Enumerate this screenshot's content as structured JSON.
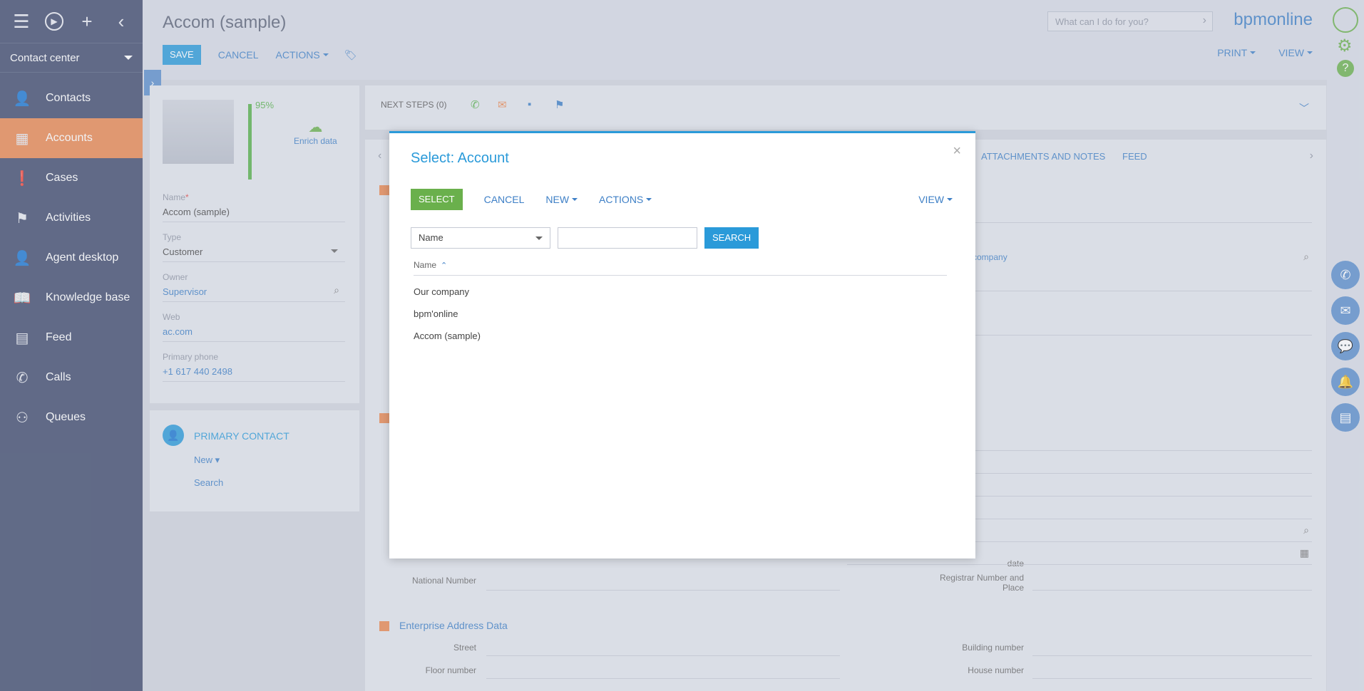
{
  "sidebar": {
    "workplace": "Contact center",
    "items": [
      {
        "label": "Contacts",
        "icon": "person-icon",
        "active": false
      },
      {
        "label": "Accounts",
        "icon": "building-icon",
        "active": true
      },
      {
        "label": "Cases",
        "icon": "exclamation-icon",
        "active": false
      },
      {
        "label": "Activities",
        "icon": "flag-icon",
        "active": false
      },
      {
        "label": "Agent desktop",
        "icon": "agent-icon",
        "active": false
      },
      {
        "label": "Knowledge base",
        "icon": "book-icon",
        "active": false
      },
      {
        "label": "Feed",
        "icon": "feed-icon",
        "active": false
      },
      {
        "label": "Calls",
        "icon": "phone-icon",
        "active": false
      },
      {
        "label": "Queues",
        "icon": "queue-icon",
        "active": false
      }
    ]
  },
  "header": {
    "title": "Accom (sample)",
    "save": "SAVE",
    "cancel": "CANCEL",
    "actions": "ACTIONS",
    "search_placeholder": "What can I do for you?",
    "brand": "bpmonline",
    "print": "PRINT",
    "view": "VIEW"
  },
  "profile": {
    "completeness": "95%",
    "enrich": "Enrich data",
    "fields": {
      "name_label": "Name",
      "name_required": "*",
      "name_value": "Accom (sample)",
      "type_label": "Type",
      "type_value": "Customer",
      "owner_label": "Owner",
      "owner_value": "Supervisor",
      "web_label": "Web",
      "web_value": "ac.com",
      "phone_label": "Primary phone",
      "phone_value": "+1 617 440 2498"
    },
    "primary_contact": {
      "title": "PRIMARY CONTACT",
      "new": "New",
      "search": "Search"
    }
  },
  "content": {
    "next_steps": "NEXT STEPS (0)",
    "tabs": [
      "ATTACHMENTS AND NOTES",
      "FEED"
    ],
    "company_link": "company",
    "date_label": "date",
    "national_number": "National Number",
    "registrar": "Registrar Number and Place",
    "address_section": "Enterprise Address Data",
    "street": "Street",
    "building_number": "Building number",
    "floor_number": "Floor number",
    "house_number": "House number"
  },
  "modal": {
    "title": "Select: Account",
    "select": "SELECT",
    "cancel": "CANCEL",
    "new": "NEW",
    "actions": "ACTIONS",
    "view": "VIEW",
    "filter_field": "Name",
    "search": "SEARCH",
    "column": "Name",
    "rows": [
      "Our company",
      "bpm'online",
      "Accom (sample)"
    ]
  },
  "colors": {
    "sidebar_bg": "#3f4a6c",
    "active_item": "#e9874f",
    "primary_blue": "#2a9ad9",
    "select_green": "#6ab04c"
  }
}
